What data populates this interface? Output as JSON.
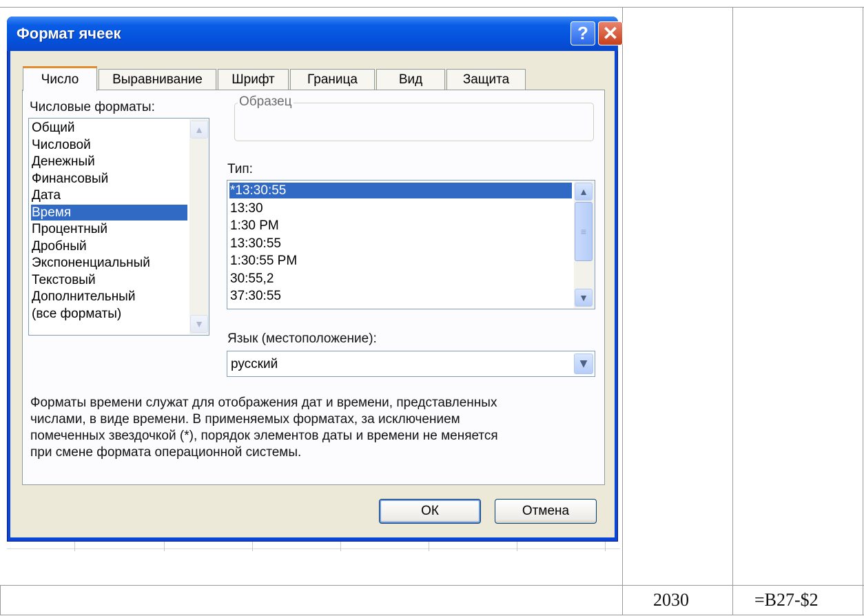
{
  "dialog": {
    "title": "Формат ячеек",
    "help_label": "?",
    "close_label": "✕",
    "tabs": [
      {
        "label": "Число",
        "active": true
      },
      {
        "label": "Выравнивание"
      },
      {
        "label": "Шрифт"
      },
      {
        "label": "Граница"
      },
      {
        "label": "Вид"
      },
      {
        "label": "Защита"
      }
    ],
    "number_formats_label": "Числовые форматы:",
    "number_formats": [
      "Общий",
      "Числовой",
      "Денежный",
      "Финансовый",
      "Дата",
      "Время",
      "Процентный",
      "Дробный",
      "Экспоненциальный",
      "Текстовый",
      "Дополнительный",
      "(все форматы)"
    ],
    "selected_format": "Время",
    "sample_label": "Образец",
    "type_label": "Тип:",
    "types": [
      "*13:30:55",
      "13:30",
      "1:30 PM",
      "13:30:55",
      "1:30:55 PM",
      "30:55,2",
      "37:30:55"
    ],
    "selected_type": "*13:30:55",
    "locale_label": "Язык (местоположение):",
    "locale_value": "русский",
    "description_lines": [
      "Форматы времени служат для отображения дат и времени, представленных",
      "числами, в виде времени. В применяемых форматах, за исключением",
      "помеченных звездочкой (*), порядок элементов даты и времени не меняется",
      "при смене формата операционной системы."
    ],
    "ok_label": "ОК",
    "cancel_label": "Отмена"
  },
  "table": {
    "cell_value": "2030",
    "cell_formula": "=B27-$2"
  },
  "colors": {
    "titlebar": "#0a5de6",
    "selection": "#316ac5",
    "tab_highlight": "#e68b2c",
    "client": "#ece9d8"
  }
}
